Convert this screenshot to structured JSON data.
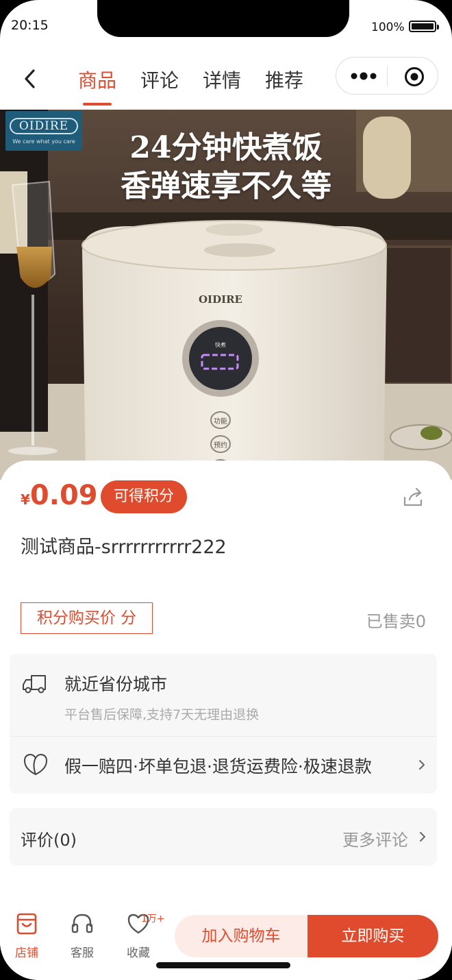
{
  "status_bar": {
    "time": "20:15",
    "battery": "100%"
  },
  "nav": {
    "tabs": [
      "商品",
      "评论",
      "详情",
      "推荐"
    ],
    "active_tab": 0
  },
  "hero": {
    "brand": "OIDIRE",
    "brand_tagline": "We care what you care",
    "headline_1": "24分钟快煮饭",
    "headline_2": "香弹速享不久等",
    "device_brand": "OIDIRE",
    "device_mode": "快煮",
    "device_btn_1": "功能",
    "device_btn_2": "预约"
  },
  "product": {
    "currency": "¥",
    "price": "0.09",
    "points_pill": "可得积分",
    "title": "测试商品-srrrrrrrrrrr222",
    "points_price": "积分购买价 分",
    "sold": "已售卖0"
  },
  "service": {
    "city": "就近省份城市",
    "after_sale": "平台售后保障,支持7天无理由退换",
    "guarantee": "假一赔四·坏单包退·退货运费险·极速退款"
  },
  "reviews": {
    "label": "评价(0)",
    "more": "更多评论"
  },
  "bottom_bar": {
    "shop": "店铺",
    "service": "客服",
    "favorite": "收藏",
    "favorite_count": "1万+",
    "add_cart": "加入购物车",
    "buy_now": "立即购买"
  },
  "colors": {
    "accent": "#e04b2e",
    "accent_light": "#fcebe6"
  }
}
